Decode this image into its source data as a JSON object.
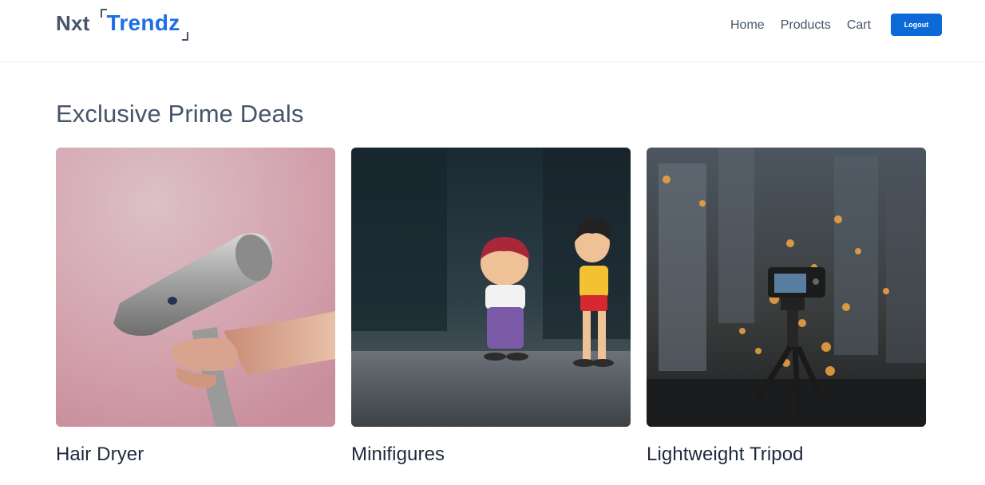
{
  "navbar": {
    "logo_prefix": "Nxt",
    "logo_brand": "Trendz",
    "links": [
      {
        "label": "Home"
      },
      {
        "label": "Products"
      },
      {
        "label": "Cart"
      }
    ],
    "logout_label": "Logout"
  },
  "colors": {
    "brand_blue": "#1e6ee8",
    "button_blue": "#0b69d8",
    "text_slate": "#475569"
  },
  "main": {
    "heading": "Exclusive Prime Deals",
    "products": [
      {
        "title": "Hair Dryer",
        "image": "hair-dryer-photo"
      },
      {
        "title": "Minifigures",
        "image": "minifigures-photo"
      },
      {
        "title": "Lightweight Tripod",
        "image": "tripod-photo"
      }
    ]
  }
}
